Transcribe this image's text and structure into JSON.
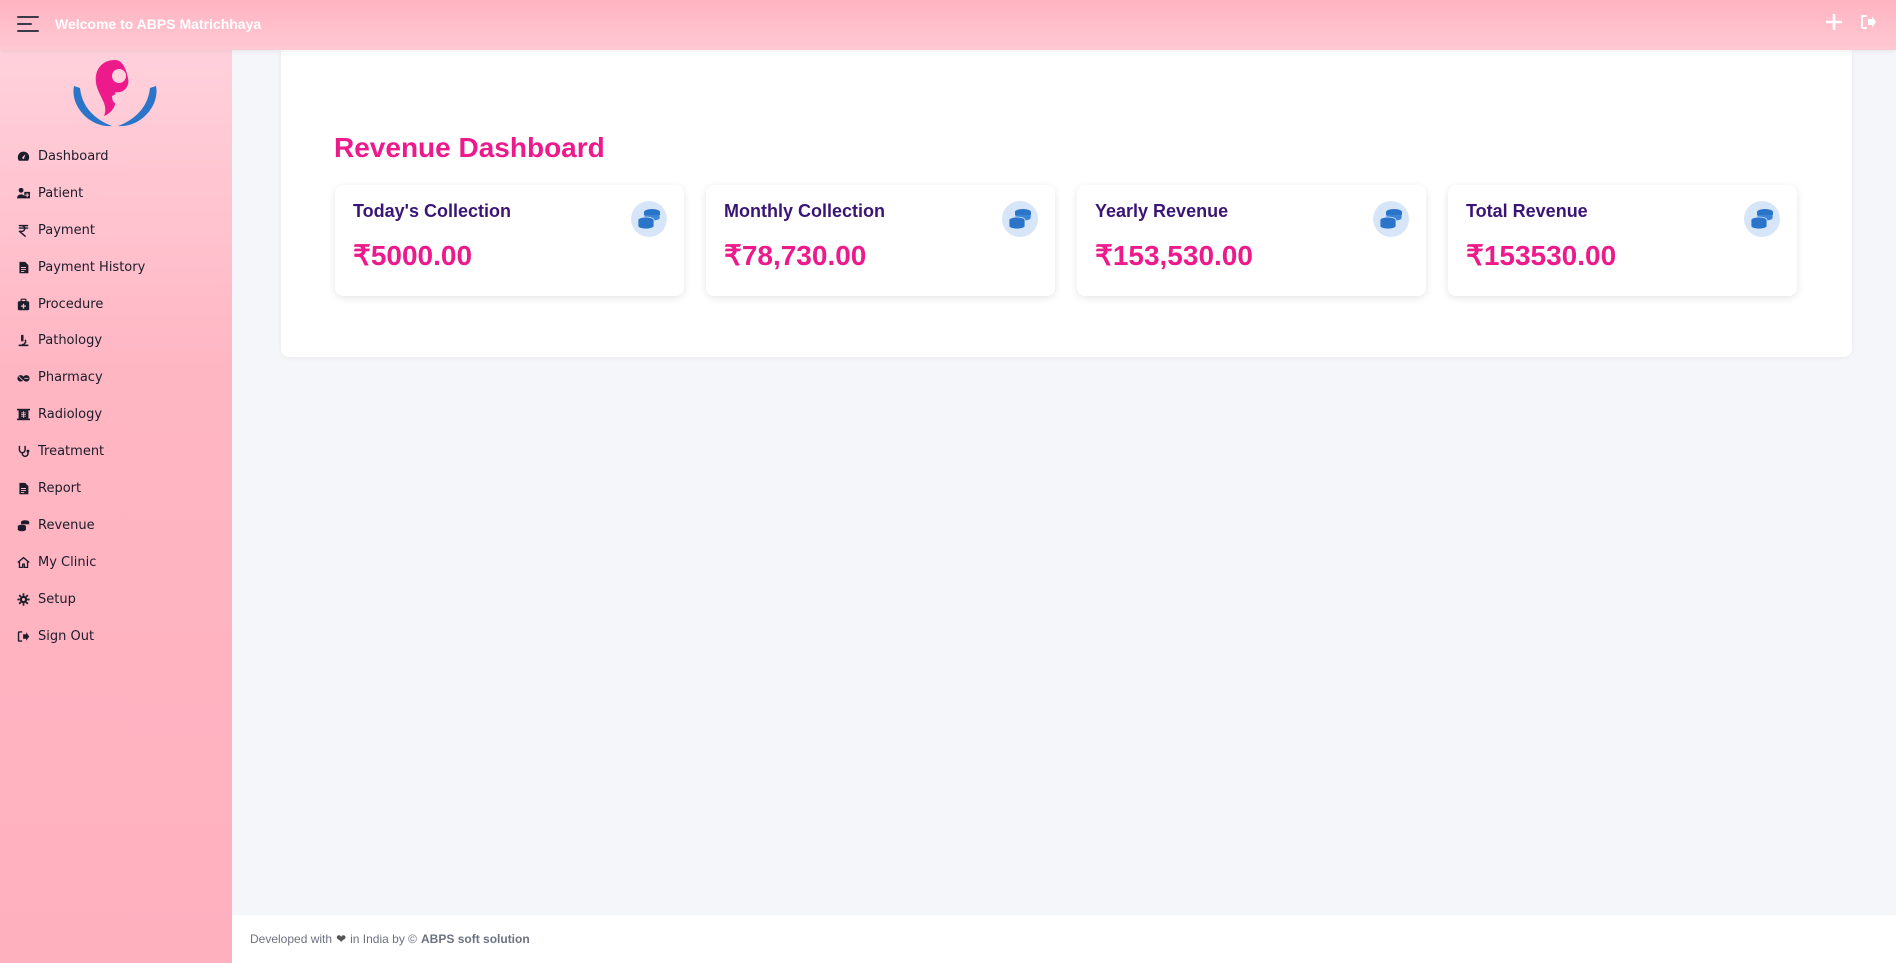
{
  "header": {
    "title": "Welcome to ABPS Matrichhaya",
    "actions": [
      {
        "icon": "plus-icon"
      },
      {
        "icon": "sign-out-icon"
      }
    ]
  },
  "sidebar": {
    "logo": "matrichhaya-logo",
    "items": [
      {
        "label": "Dashboard",
        "icon": "dashboard-icon"
      },
      {
        "label": "Patient",
        "icon": "patient-icon"
      },
      {
        "label": "Payment",
        "icon": "rupee-icon"
      },
      {
        "label": "Payment History",
        "icon": "file-icon"
      },
      {
        "label": "Procedure",
        "icon": "medkit-icon"
      },
      {
        "label": "Pathology",
        "icon": "microscope-icon"
      },
      {
        "label": "Pharmacy",
        "icon": "pills-icon"
      },
      {
        "label": "Radiology",
        "icon": "x-ray-icon"
      },
      {
        "label": "Treatment",
        "icon": "stethoscope-icon"
      },
      {
        "label": "Report",
        "icon": "report-icon"
      },
      {
        "label": "Revenue",
        "icon": "coins-icon"
      },
      {
        "label": "My Clinic",
        "icon": "home-icon"
      },
      {
        "label": "Setup",
        "icon": "gear-icon"
      },
      {
        "label": "Sign Out",
        "icon": "sign-out-icon"
      }
    ]
  },
  "main": {
    "title": "Revenue Dashboard",
    "cards": [
      {
        "label": "Today's Collection",
        "value": "₹5000.00",
        "icon": "database-icon"
      },
      {
        "label": "Monthly Collection",
        "value": "₹78,730.00",
        "icon": "database-icon"
      },
      {
        "label": "Yearly Revenue",
        "value": "₹153,530.00",
        "icon": "database-icon"
      },
      {
        "label": "Total Revenue",
        "value": "₹153530.00",
        "icon": "database-icon"
      }
    ]
  },
  "footer": {
    "prefix": "Developed with",
    "middle": "in India by ©",
    "company": "ABPS soft solution"
  },
  "colors": {
    "accent": "#ec1a8b",
    "label": "#3b1575",
    "topbar": "#ffb3c1",
    "sidebar": "#ffb6c3"
  }
}
